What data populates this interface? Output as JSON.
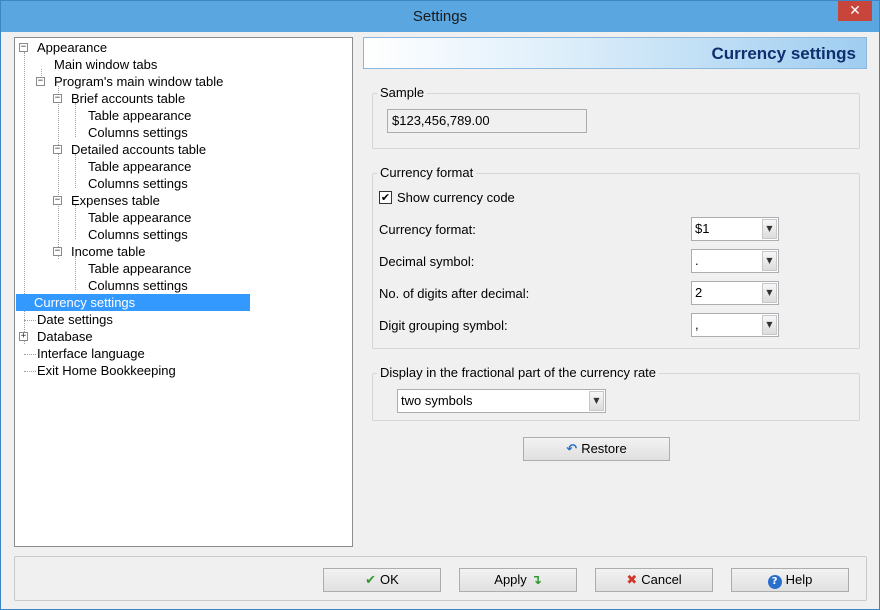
{
  "window": {
    "title": "Settings",
    "close_glyph": "✕"
  },
  "tree": {
    "expander_minus": "⊟",
    "expander_plus": "⊞",
    "items": [
      {
        "label": "Appearance"
      },
      {
        "label": "Main window tabs"
      },
      {
        "label": "Program's main window table"
      },
      {
        "label": "Brief accounts table"
      },
      {
        "label": "Table appearance"
      },
      {
        "label": "Columns settings"
      },
      {
        "label": "Detailed accounts table"
      },
      {
        "label": "Table appearance"
      },
      {
        "label": "Columns settings"
      },
      {
        "label": "Expenses table"
      },
      {
        "label": "Table appearance"
      },
      {
        "label": "Columns settings"
      },
      {
        "label": "Income table"
      },
      {
        "label": "Table appearance"
      },
      {
        "label": "Columns settings"
      },
      {
        "label": "Currency settings"
      },
      {
        "label": "Date settings"
      },
      {
        "label": "Database"
      },
      {
        "label": "Interface language"
      },
      {
        "label": "Exit Home Bookkeeping"
      }
    ]
  },
  "header": {
    "title": "Currency settings"
  },
  "sample": {
    "legend": "Sample",
    "value": "$123,456,789.00"
  },
  "format": {
    "legend": "Currency format",
    "show_code_label": "Show currency code",
    "show_code_checked": "✔",
    "rows": [
      {
        "label": "Currency format:",
        "value": "$1"
      },
      {
        "label": "Decimal symbol:",
        "value": "."
      },
      {
        "label": "No. of digits after decimal:",
        "value": "2"
      },
      {
        "label": "Digit grouping symbol:",
        "value": ","
      }
    ],
    "arrow_glyph": "▼"
  },
  "fraction": {
    "legend": "Display in the fractional part of the currency rate",
    "value": "two symbols"
  },
  "restore": {
    "label": "Restore",
    "icon": "↶"
  },
  "buttons": {
    "ok": {
      "label": "OK",
      "icon": "✔",
      "color": "#2e9a2e"
    },
    "apply": {
      "label": "Apply",
      "icon": "↴",
      "color": "#2e9a2e"
    },
    "cancel": {
      "label": "Cancel",
      "icon": "✖",
      "color": "#d2352a"
    },
    "help": {
      "label": "Help",
      "icon": "?",
      "color": "#2a6fc9"
    }
  }
}
